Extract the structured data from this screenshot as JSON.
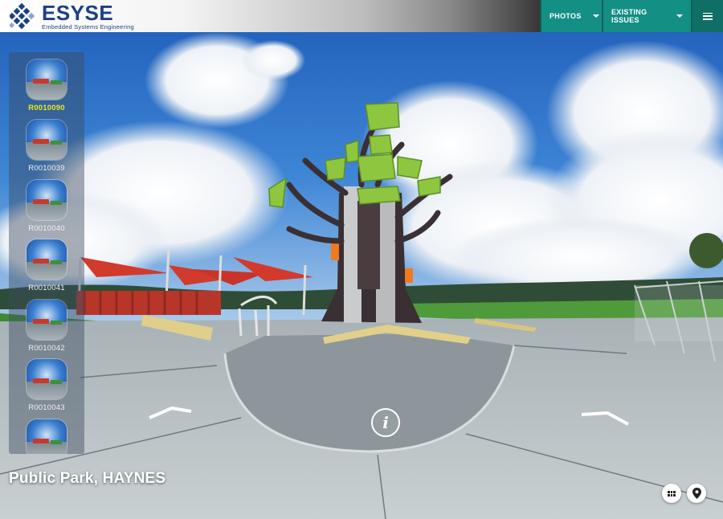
{
  "header": {
    "brand_name": "ESYSE",
    "brand_tagline": "Embedded Systems Engineering",
    "nav": {
      "photos_label": "PHOTOS",
      "issues_label": "EXISTING ISSUES"
    },
    "icons": {
      "logo": "esyse-logo-icon",
      "menu": "hamburger-menu-icon",
      "caret": "chevron-down-icon"
    }
  },
  "sidebar": {
    "items": [
      {
        "label": "R0010090",
        "active": true
      },
      {
        "label": "R0010039",
        "active": false
      },
      {
        "label": "R0010040",
        "active": false
      },
      {
        "label": "R0010041",
        "active": false
      },
      {
        "label": "R0010042",
        "active": false
      },
      {
        "label": "R0010043",
        "active": false
      },
      {
        "label": "",
        "active": false
      }
    ]
  },
  "viewer": {
    "location_title": "Public Park, HAYNES",
    "info_glyph": "i",
    "icons": {
      "info": "info-icon",
      "grid": "grid-view-icon",
      "map": "map-pin-icon",
      "arrow": "chevron-up-icon"
    }
  },
  "colors": {
    "teal": "#138f84",
    "brand_blue": "#1c3f86",
    "active_label": "#e8e81e"
  }
}
